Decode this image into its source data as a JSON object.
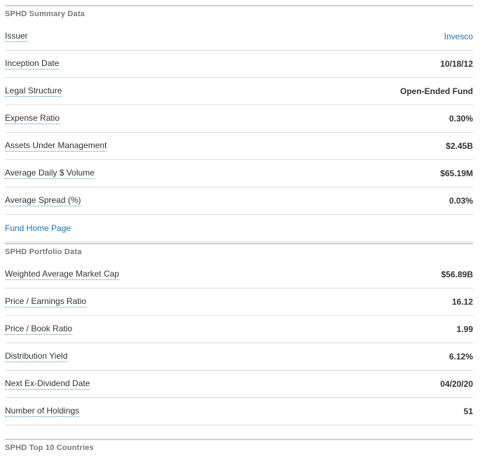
{
  "summary": {
    "title": "SPHD Summary Data",
    "rows": [
      {
        "label": "Issuer",
        "value": "Invesco"
      },
      {
        "label": "Inception Date",
        "value": "10/18/12"
      },
      {
        "label": "Legal Structure",
        "value": "Open-Ended Fund"
      },
      {
        "label": "Expense Ratio",
        "value": "0.30%"
      },
      {
        "label": "Assets Under Management",
        "value": "$2.45B"
      },
      {
        "label": "Average Daily $ Volume",
        "value": "$65.19M"
      },
      {
        "label": "Average Spread (%)",
        "value": "0.03%"
      }
    ],
    "fund_home_link": "Fund Home Page"
  },
  "portfolio": {
    "title": "SPHD Portfolio Data",
    "rows": [
      {
        "label": "Weighted Average Market Cap",
        "value": "$56.89B"
      },
      {
        "label": "Price / Earnings Ratio",
        "value": "16.12"
      },
      {
        "label": "Price / Book Ratio",
        "value": "1.99"
      },
      {
        "label": "Distribution Yield",
        "value": "6.12%"
      },
      {
        "label": "Next Ex-Dividend Date",
        "value": "04/20/20"
      },
      {
        "label": "Number of Holdings",
        "value": "51"
      }
    ]
  },
  "next_section": {
    "title": "SPHD Top 10 Countries"
  },
  "colors": {
    "link": "#1a73b5",
    "label_underline": "#3c91c6",
    "header_text": "#777777",
    "divider": "#dcdcdc"
  }
}
